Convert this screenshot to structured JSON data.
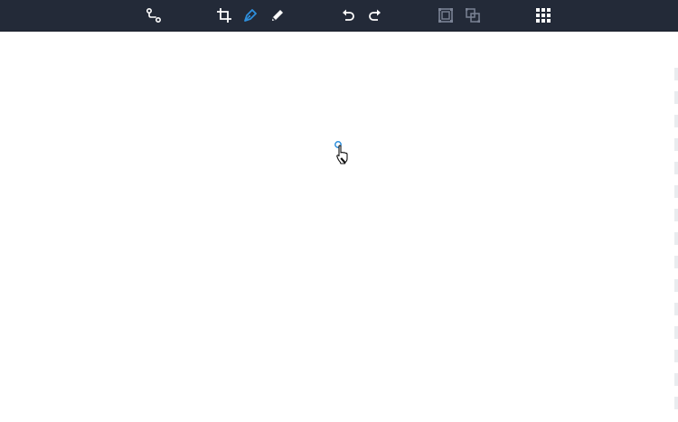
{
  "toolbar": {
    "background": "#232a38",
    "icon_color": "#ffffff",
    "active_color": "#2e8fdc",
    "disabled_color": "#7a8294",
    "tools": [
      {
        "name": "connector-tool",
        "icon": "path-connector-icon",
        "state": "enabled"
      },
      {
        "name": "crop-tool",
        "icon": "crop-icon",
        "state": "enabled"
      },
      {
        "name": "pen-tool",
        "icon": "pen-nib-icon",
        "state": "active"
      },
      {
        "name": "pencil-tool",
        "icon": "pencil-icon",
        "state": "enabled"
      },
      {
        "name": "undo",
        "icon": "undo-icon",
        "state": "enabled"
      },
      {
        "name": "redo",
        "icon": "redo-icon",
        "state": "enabled"
      },
      {
        "name": "group",
        "icon": "group-icon",
        "state": "disabled"
      },
      {
        "name": "ungroup",
        "icon": "ungroup-icon",
        "state": "disabled"
      },
      {
        "name": "grid-menu",
        "icon": "grid-icon",
        "state": "enabled"
      }
    ]
  },
  "canvas": {
    "background": "#ffffff",
    "anchor_color": "#2e8fdc"
  }
}
